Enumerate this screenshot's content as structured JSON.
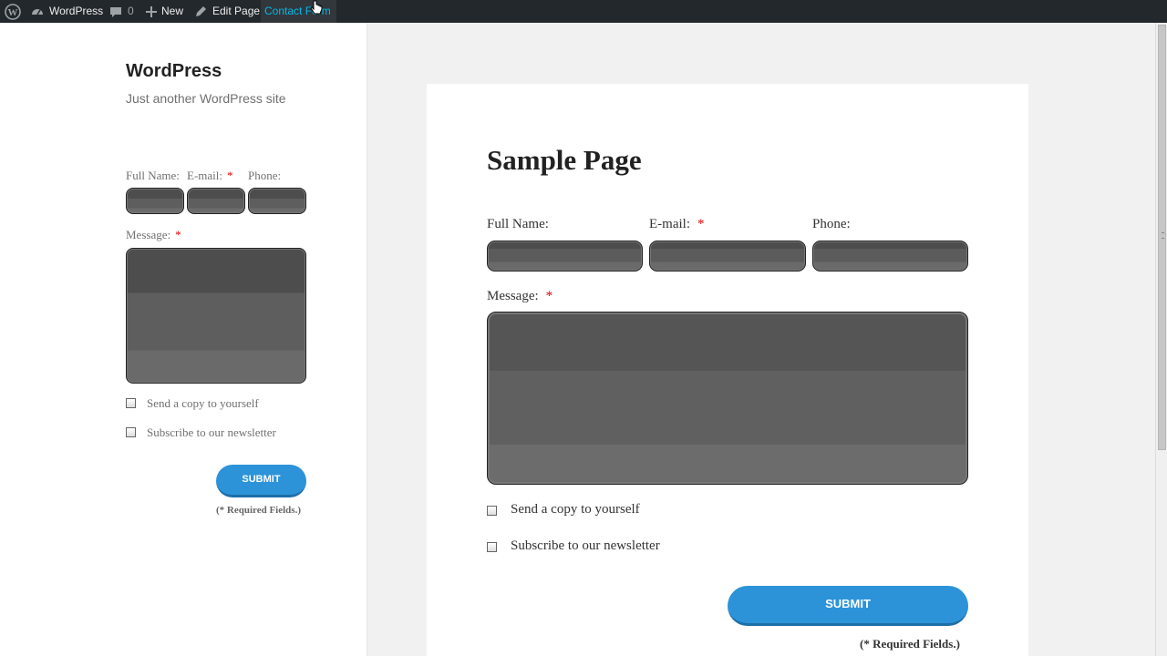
{
  "admin_bar": {
    "site_name": "WordPress",
    "comments_count": "0",
    "new_label": "New",
    "edit_page_label": "Edit Page",
    "contact_form_label": "Contact Form",
    "icons": [
      "wordpress-logo-icon",
      "dashboard-icon",
      "comment-icon",
      "plus-icon",
      "pencil-icon"
    ]
  },
  "site": {
    "title": "WordPress",
    "tagline": "Just another WordPress site"
  },
  "widget_form": {
    "full_name_label": "Full Name:",
    "email_label": "E-mail:",
    "phone_label": "Phone:",
    "message_label": "Message:",
    "required_mark": "*",
    "copy_label": "Send a copy to yourself",
    "newsletter_label": "Subscribe to our newsletter",
    "submit_label": "SUBMIT",
    "required_note": "(* Required Fields.)"
  },
  "page": {
    "title": "Sample Page",
    "form": {
      "full_name_label": "Full Name:",
      "email_label": "E-mail:",
      "phone_label": "Phone:",
      "message_label": "Message:",
      "required_mark": "*",
      "copy_label": "Send a copy to yourself",
      "newsletter_label": "Subscribe to our newsletter",
      "submit_label": "SUBMIT",
      "required_note": "(* Required Fields.)"
    }
  },
  "colors": {
    "admin_bar_bg": "#23282d",
    "accent": "#2c93d9",
    "required": "#dd0000",
    "active_link": "#00b9eb"
  }
}
